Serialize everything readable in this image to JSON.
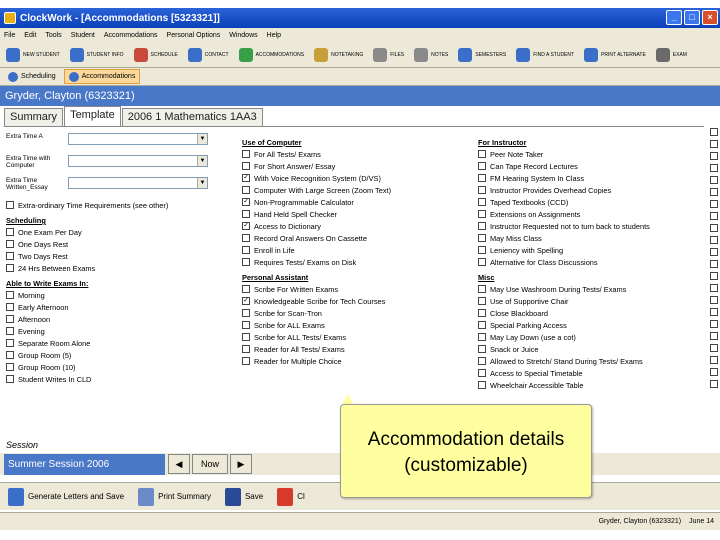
{
  "window": {
    "title": "ClockWork - [Accommodations [5323321]]"
  },
  "menu": [
    "File",
    "Edit",
    "Tools",
    "Student",
    "Accommodations",
    "Personal Options",
    "Windows",
    "Help"
  ],
  "toolbar": [
    {
      "label": "NEW STUDENT",
      "color": "#3a6ec8"
    },
    {
      "label": "STUDENT INFO",
      "color": "#3a6ec8"
    },
    {
      "label": "SCHEDULE",
      "color": "#c84a3a"
    },
    {
      "label": "CONTACT",
      "color": "#3a6ec8"
    },
    {
      "label": "ACCOMMODATIONS",
      "color": "#3aa048"
    },
    {
      "label": "NOTETAKING",
      "color": "#c8a03a"
    },
    {
      "label": "FILES",
      "color": "#8a8a8a"
    },
    {
      "label": "NOTES",
      "color": "#8a8a8a"
    },
    {
      "label": "SEMESTERS",
      "color": "#3a6ec8"
    },
    {
      "label": "FIND A STUDENT",
      "color": "#3a6ec8"
    },
    {
      "label": "PRINT ALTERNATE",
      "color": "#3a6ec8"
    },
    {
      "label": "EXAM",
      "color": "#6a6a6a"
    }
  ],
  "subtabs": [
    {
      "label": "Scheduling",
      "active": false
    },
    {
      "label": "Accommodations",
      "active": true
    }
  ],
  "student_name": "Gryder, Clayton (6323321)",
  "tabs": [
    {
      "label": "Summary",
      "active": false
    },
    {
      "label": "Template",
      "active": true
    },
    {
      "label": "2006 1 Mathematics 1AA3",
      "active": false
    }
  ],
  "fields": [
    {
      "label": "Extra Time A"
    },
    {
      "label": "Extra Time with Computer"
    },
    {
      "label": "Extra Time Written_Essay"
    }
  ],
  "extra_time_checkbox": {
    "label": "Extra-ordinary Time Requirements (see other)",
    "checked": false
  },
  "col1_sections": [
    {
      "header": "Scheduling",
      "items": [
        {
          "label": "One Exam Per Day",
          "checked": false
        },
        {
          "label": "One Days Rest",
          "checked": false
        },
        {
          "label": "Two Days Rest",
          "checked": false
        },
        {
          "label": "24 Hrs Between Exams",
          "checked": false
        }
      ]
    },
    {
      "header": "Able to Write Exams In:",
      "items": [
        {
          "label": "Morning",
          "checked": false
        },
        {
          "label": "Early Afternoon",
          "checked": false
        },
        {
          "label": "Afternoon",
          "checked": false
        },
        {
          "label": "Evening",
          "checked": false
        },
        {
          "label": "Separate Room Alone",
          "checked": false
        },
        {
          "label": "Group Room (5)",
          "checked": false
        },
        {
          "label": "Group Room (10)",
          "checked": false
        },
        {
          "label": "Student Writes In CLD",
          "checked": false
        }
      ]
    }
  ],
  "col2_sections": [
    {
      "header": "Use of Computer",
      "items": [
        {
          "label": "For All Tests/ Exams",
          "checked": false
        },
        {
          "label": "For Short Answer/ Essay",
          "checked": false
        },
        {
          "label": "With Voice Recognition System (D/VS)",
          "checked": true
        },
        {
          "label": "Computer With Large Screen (Zoom Text)",
          "checked": false
        },
        {
          "label": "Non-Programmable Calculator",
          "checked": true
        },
        {
          "label": "Hand Held Spell Checker",
          "checked": false
        },
        {
          "label": "Access to Dictionary",
          "checked": true
        },
        {
          "label": "Record Oral Answers On Cassette",
          "checked": false
        },
        {
          "label": "Enroll in Life",
          "checked": false
        },
        {
          "label": "Requires Tests/ Exams on Disk",
          "checked": false
        }
      ]
    },
    {
      "header": "Personal Assistant",
      "items": [
        {
          "label": "Scribe For Written Exams",
          "checked": false
        },
        {
          "label": "Knowledgeable Scribe for Tech Courses",
          "checked": true
        },
        {
          "label": "Scribe for Scan-Tron",
          "checked": false
        },
        {
          "label": "Scribe for ALL Exams",
          "checked": false
        },
        {
          "label": "Scribe for ALL Tests/ Exams",
          "checked": false
        },
        {
          "label": "Reader for All Tests/ Exams",
          "checked": false
        },
        {
          "label": "Reader for Multiple Choice",
          "checked": false
        }
      ]
    }
  ],
  "col3_sections": [
    {
      "header": "For Instructor",
      "items": [
        {
          "label": "Peer Note Taker",
          "checked": false
        },
        {
          "label": "Can Tape Record Lectures",
          "checked": false
        },
        {
          "label": "FM Hearing System In Class",
          "checked": false
        },
        {
          "label": "Instructor Provides Overhead Copies",
          "checked": false
        },
        {
          "label": "Taped Textbooks (CCD)",
          "checked": false
        },
        {
          "label": "Extensions on Assignments",
          "checked": false
        },
        {
          "label": "Instructor Requested not to turn back to students",
          "checked": false
        },
        {
          "label": "May Miss Class",
          "checked": false
        },
        {
          "label": "Leniency with Spelling",
          "checked": false
        },
        {
          "label": "Alternative for Class Discussions",
          "checked": false
        }
      ]
    },
    {
      "header": "Misc",
      "items": [
        {
          "label": "May Use Washroom During Tests/ Exams",
          "checked": false
        },
        {
          "label": "Use of Supportive Chair",
          "checked": false
        },
        {
          "label": "Close Blackboard",
          "checked": false
        },
        {
          "label": "Special Parking Access",
          "checked": false
        },
        {
          "label": "May Lay Down (use a cot)",
          "checked": false
        },
        {
          "label": "Snack or Juice",
          "checked": false
        },
        {
          "label": "Allowed to Stretch/ Stand During Tests/ Exams",
          "checked": false
        },
        {
          "label": "Access to Special Timetable",
          "checked": false
        },
        {
          "label": "Wheelchair Accessible Table",
          "checked": false
        }
      ]
    }
  ],
  "session": {
    "label": "Session",
    "value": "Summer Session 2006",
    "now_label": "Now"
  },
  "actions": [
    {
      "label": "Generate Letters and Save",
      "color": "#3a6ec8"
    },
    {
      "label": "Print Summary",
      "color": "#6a8ac8"
    },
    {
      "label": "Save",
      "color": "#2a4a98"
    },
    {
      "label": "Cl",
      "color": "#d83a2a"
    }
  ],
  "statusbar": {
    "user": "Gryder, Clayton (6323321)",
    "date": "June 14"
  },
  "callout": {
    "line1": "Accommodation details",
    "line2": "(customizable)"
  }
}
